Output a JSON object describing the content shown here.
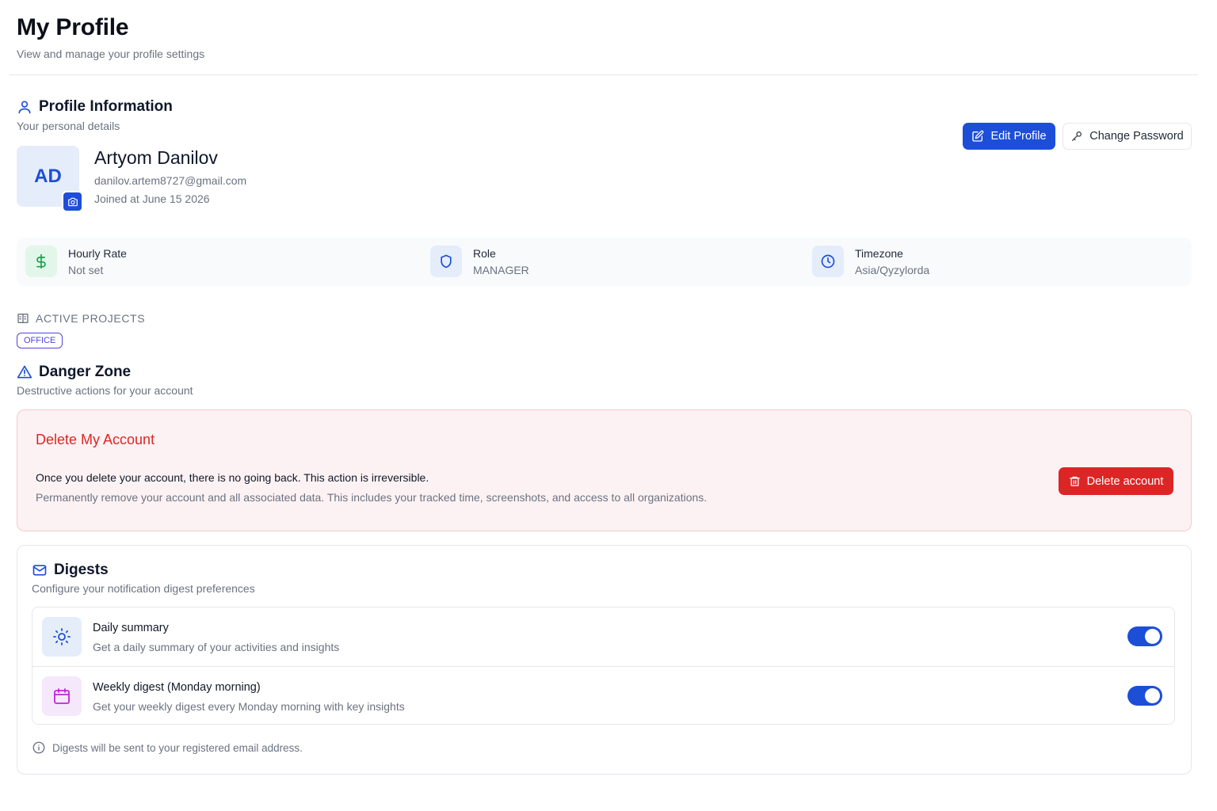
{
  "page": {
    "title": "My Profile",
    "subtitle": "View and manage your profile settings"
  },
  "profile": {
    "section_title": "Profile Information",
    "section_subtitle": "Your personal details",
    "initials": "AD",
    "name": "Artyom Danilov",
    "email": "danilov.artem8727@gmail.com",
    "joined": "Joined at June 15 2026",
    "edit_label": "Edit Profile",
    "change_password_label": "Change Password"
  },
  "info": {
    "hourly_rate": {
      "label": "Hourly Rate",
      "value": "Not set",
      "icon": "dollar-icon",
      "color": "#16a34a"
    },
    "role": {
      "label": "Role",
      "value": "MANAGER",
      "icon": "shield-icon",
      "color": "#1d4ed8"
    },
    "timezone": {
      "label": "Timezone",
      "value": "Asia/Qyzylorda",
      "icon": "clock-icon",
      "color": "#1d4ed8"
    }
  },
  "projects": {
    "heading": "ACTIVE PROJECTS",
    "items": [
      "OFFICE"
    ]
  },
  "danger": {
    "section_title": "Danger Zone",
    "section_subtitle": "Destructive actions for your account",
    "card_title": "Delete My Account",
    "warning": "Once you delete your account, there is no going back. This action is irreversible.",
    "description": "Permanently remove your account and all associated data. This includes your tracked time, screenshots, and access to all organizations.",
    "button_label": "Delete account"
  },
  "digests": {
    "title": "Digests",
    "subtitle": "Configure your notification digest preferences",
    "items": [
      {
        "title": "Daily summary",
        "description": "Get a daily summary of your activities and insights",
        "enabled": true,
        "icon": "sun-icon"
      },
      {
        "title": "Weekly digest (Monday morning)",
        "description": "Get your weekly digest every Monday morning with key insights",
        "enabled": true,
        "icon": "calendar-icon"
      }
    ],
    "note": "Digests will be sent to your registered email address."
  },
  "colors": {
    "primary": "#1d4ed8",
    "danger": "#dc2626",
    "danger_bg": "#fdf2f3",
    "project_badge": "#4f46e5"
  }
}
